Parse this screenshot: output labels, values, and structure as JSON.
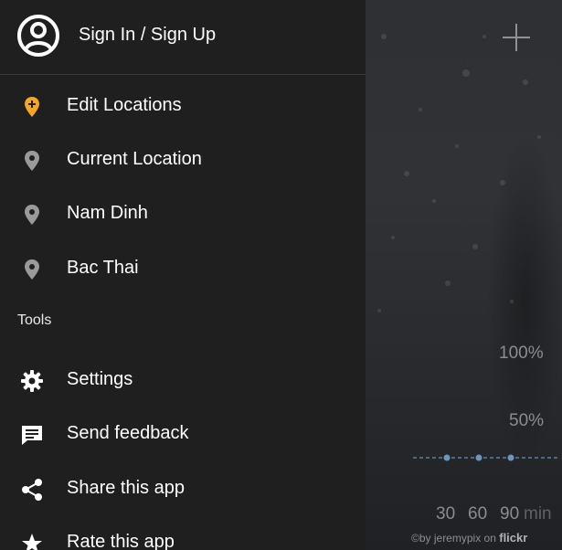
{
  "account": {
    "label": "Sign In / Sign Up",
    "icon": "account-circle-icon"
  },
  "locations": [
    {
      "label": "Edit Locations",
      "icon": "add-location-icon",
      "color": "#f5a623"
    },
    {
      "label": "Current Location",
      "icon": "location-pin-icon",
      "color": "#9a9a9a"
    },
    {
      "label": "Nam Dinh",
      "icon": "location-pin-icon",
      "color": "#9a9a9a"
    },
    {
      "label": "Bac Thai",
      "icon": "location-pin-icon",
      "color": "#9a9a9a"
    }
  ],
  "tools": {
    "title": "Tools",
    "items": [
      {
        "label": "Settings",
        "icon": "gear-icon"
      },
      {
        "label": "Send feedback",
        "icon": "feedback-icon"
      },
      {
        "label": "Share this app",
        "icon": "share-icon"
      },
      {
        "label": "Rate this app",
        "icon": "star-icon"
      }
    ]
  },
  "background": {
    "add_button": "plus-icon",
    "precip_labels": {
      "high": "100%",
      "mid": "50%"
    },
    "time_ticks": [
      "30",
      "60",
      "90",
      "min"
    ],
    "credit": {
      "prefix": "©by jeremypix on",
      "brand": "flickr"
    }
  },
  "colors": {
    "drawer_bg": "#1f1f1f",
    "accent": "#f5a623",
    "rain_line": "#5b7fa3"
  }
}
